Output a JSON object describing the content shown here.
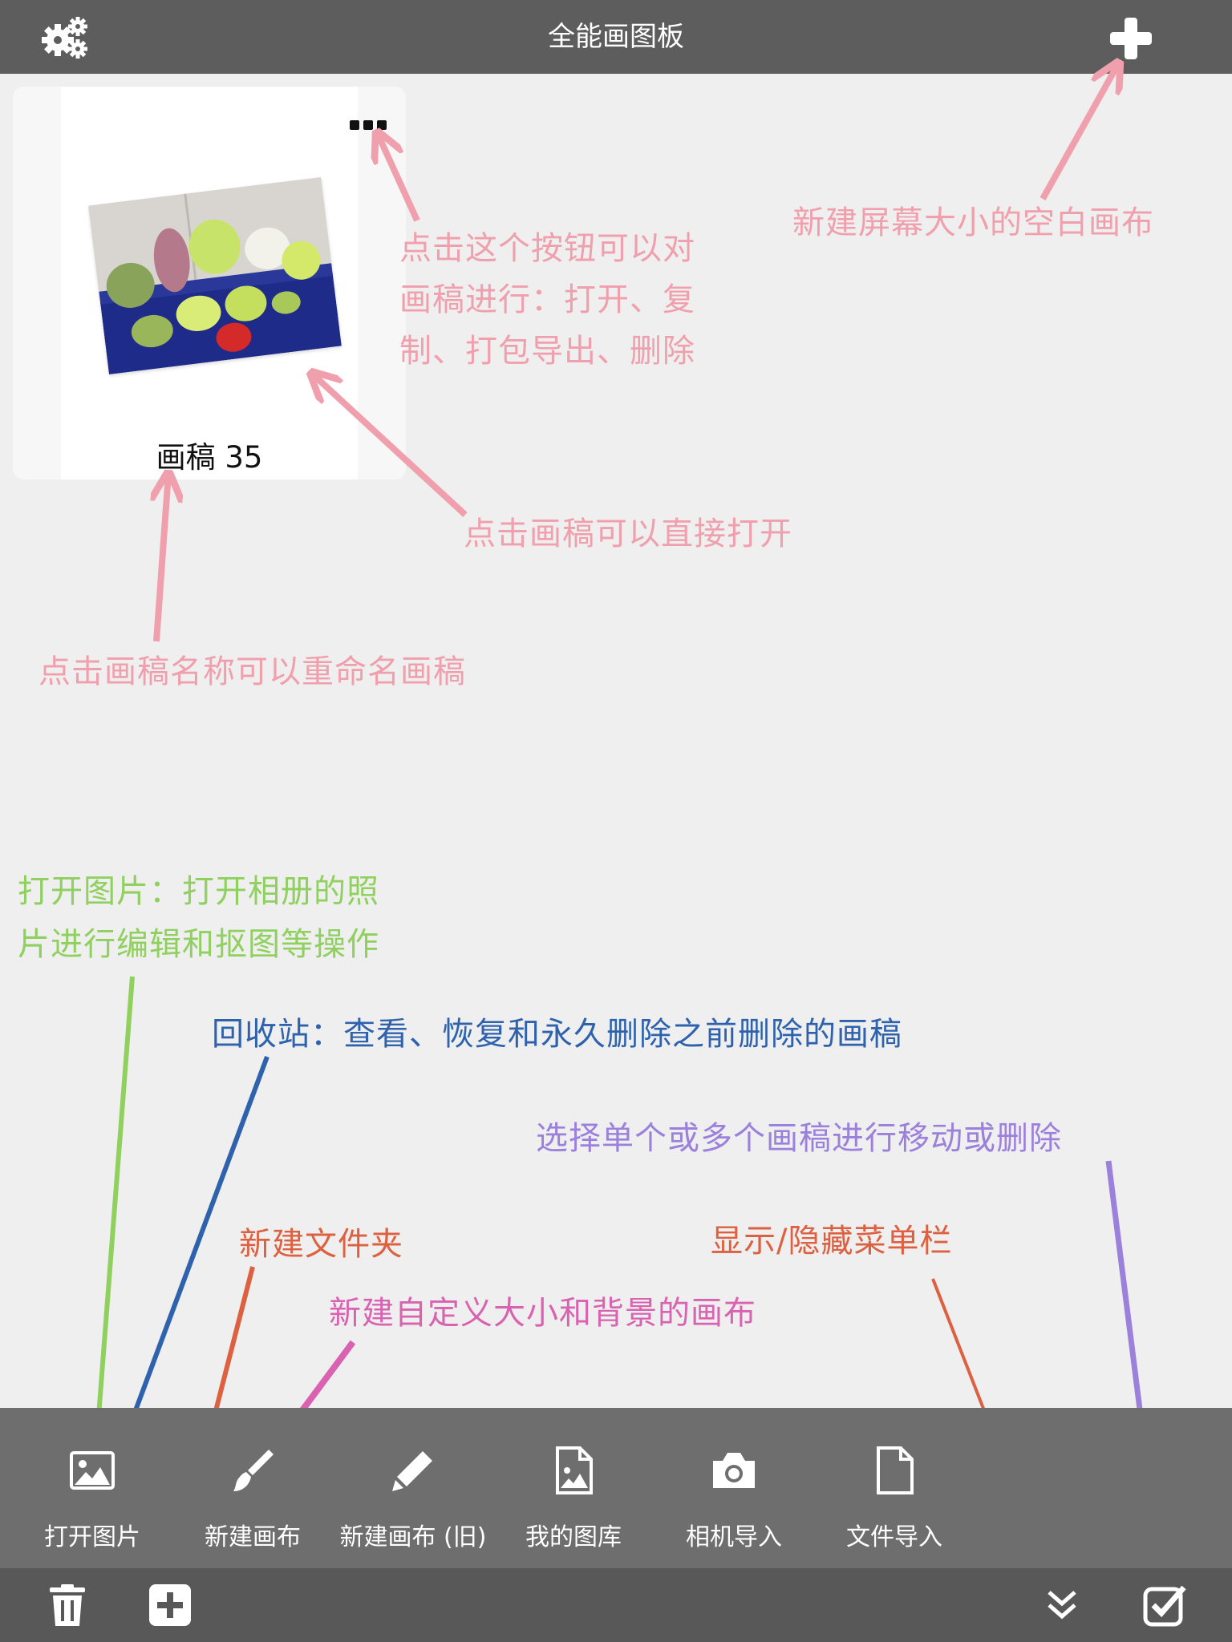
{
  "header": {
    "title": "全能画图板"
  },
  "drafts": [
    {
      "name": "画稿 35"
    }
  ],
  "annotations": {
    "more_button": "点击这个按钮可以对\n画稿进行：打开、复\n制、打包导出、删除",
    "new_blank": "新建屏幕大小的空白画布",
    "open_draft": "点击画稿可以直接打开",
    "rename": "点击画稿名称可以重命名画稿",
    "open_image": "打开图片：打开相册的照\n片进行编辑和抠图等操作",
    "recycle": "回收站：查看、恢复和永久删除之前删除的画稿",
    "select": "选择单个或多个画稿进行移动或删除",
    "new_folder": "新建文件夹",
    "toggle_menu": "显示/隐藏菜单栏",
    "custom_canvas": "新建自定义大小和背景的画布"
  },
  "toolbar": [
    {
      "label": "打开图片",
      "icon": "image-icon"
    },
    {
      "label": "新建画布",
      "icon": "brush-icon"
    },
    {
      "label": "新建画布 (旧)",
      "icon": "pencil-icon"
    },
    {
      "label": "我的图库",
      "icon": "gallery-file-icon"
    },
    {
      "label": "相机导入",
      "icon": "camera-icon"
    },
    {
      "label": "文件导入",
      "icon": "file-icon"
    }
  ],
  "colors": {
    "bar": "#5d5d5d",
    "toolbar": "#6e6e6e",
    "pink": "#f0a0ad",
    "green": "#8fd05e",
    "blue": "#2f62ad",
    "orange": "#dd6040",
    "magenta": "#d963b0",
    "purple": "#9b80dc"
  }
}
